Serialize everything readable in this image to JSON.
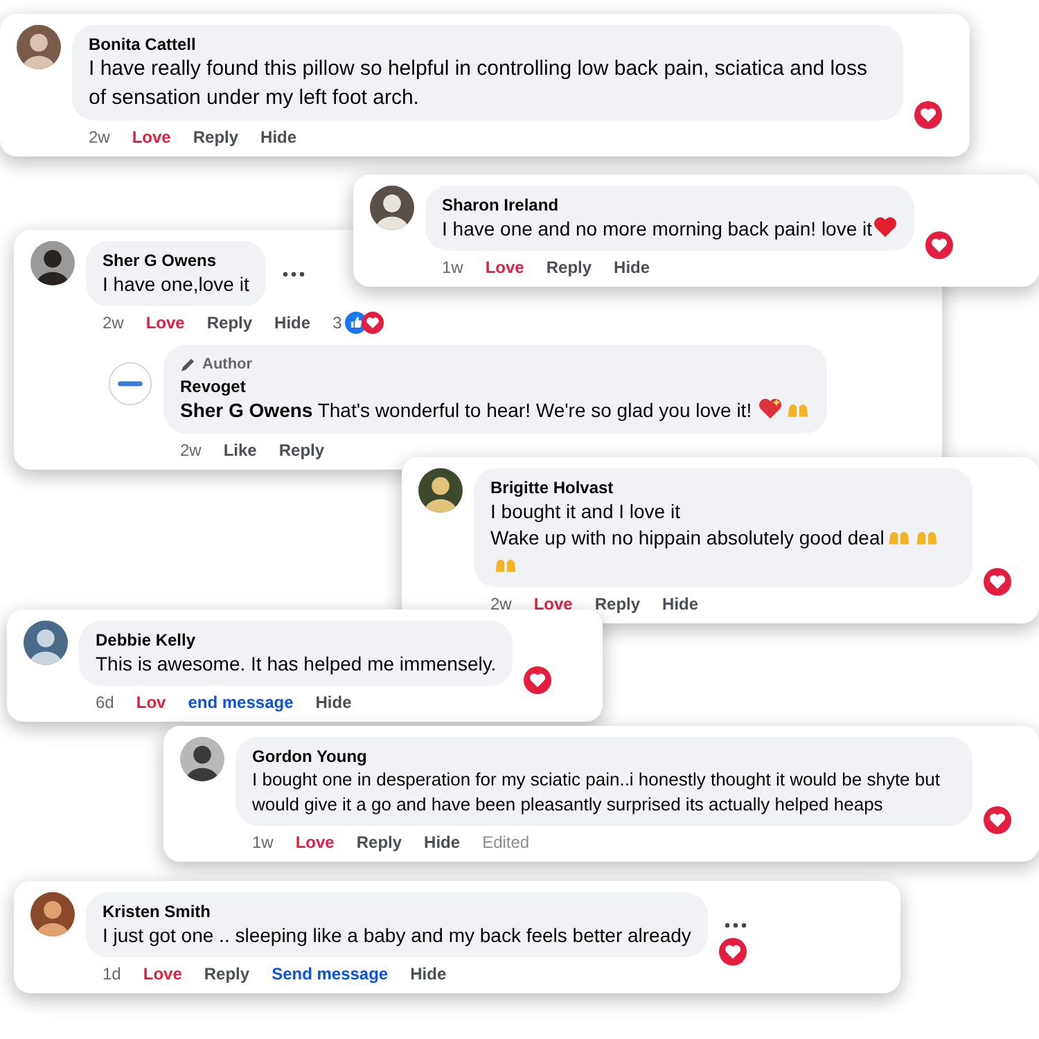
{
  "comments": [
    {
      "author": "Bonita Cattell",
      "text": "I have really found this pillow so helpful in controlling low back pain, sciatica and loss of sensation under my left foot arch.",
      "actions": [
        {
          "label": "2w",
          "kind": "time"
        },
        {
          "label": "Love",
          "kind": "love"
        },
        {
          "label": "Reply",
          "kind": "action"
        },
        {
          "label": "Hide",
          "kind": "action"
        }
      ],
      "loved": true
    },
    {
      "author": "Sharon Ireland",
      "text": "I have one and no more morning back pain! love it",
      "trailing": [
        {
          "kind": "heart"
        }
      ],
      "actions": [
        {
          "label": "1w",
          "kind": "time"
        },
        {
          "label": "Love",
          "kind": "love"
        },
        {
          "label": "Reply",
          "kind": "action"
        },
        {
          "label": "Hide",
          "kind": "action"
        }
      ],
      "loved": true
    },
    {
      "author": "Sher G Owens",
      "text": "I have one,love it",
      "menu": true,
      "actions": [
        {
          "label": "2w",
          "kind": "time"
        },
        {
          "label": "Love",
          "kind": "love"
        },
        {
          "label": "Reply",
          "kind": "action"
        },
        {
          "label": "Hide",
          "kind": "action"
        }
      ],
      "reaction_count": "3",
      "replies": [
        {
          "badge": "Author",
          "author": "Revoget",
          "text": "**Sher G Owens** That's wonderful to hear! We're so glad you love it!",
          "trailing": [
            {
              "kind": "sparkle-heart"
            },
            {
              "kind": "hands"
            }
          ],
          "actions": [
            {
              "label": "2w",
              "kind": "time"
            },
            {
              "label": "Like",
              "kind": "action"
            },
            {
              "label": "Reply",
              "kind": "action"
            }
          ]
        }
      ]
    },
    {
      "author": "Brigitte Holvast",
      "text": "I bought it and I love it\nWake up with no hippain absolutely good deal",
      "trailing": [
        {
          "kind": "hands"
        },
        {
          "kind": "hands"
        },
        {
          "kind": "hands"
        }
      ],
      "actions": [
        {
          "label": "2w",
          "kind": "time"
        },
        {
          "label": "Love",
          "kind": "love"
        },
        {
          "label": "Reply",
          "kind": "action"
        },
        {
          "label": "Hide",
          "kind": "action"
        }
      ],
      "loved": true
    },
    {
      "author": "Debbie Kelly",
      "text": "This is awesome. It has helped me immensely.",
      "actions": [
        {
          "label": "6d",
          "kind": "time"
        },
        {
          "label": "Lov",
          "kind": "love"
        },
        {
          "label": "end message",
          "kind": "link"
        },
        {
          "label": "Hide",
          "kind": "action"
        }
      ],
      "loved": true
    },
    {
      "author": "Gordon Young",
      "text": "I bought one in desperation for my sciatic pain..i honestly thought it would be shyte but would give it a go and have been pleasantly surprised its actually helped heaps",
      "actions": [
        {
          "label": "1w",
          "kind": "time"
        },
        {
          "label": "Love",
          "kind": "love"
        },
        {
          "label": "Reply",
          "kind": "action"
        },
        {
          "label": "Hide",
          "kind": "action"
        },
        {
          "label": "Edited",
          "kind": "note"
        }
      ],
      "loved": true
    },
    {
      "author": "Kristen Smith",
      "text": "I just got one .. sleeping like a baby and my back feels better already",
      "menu": true,
      "actions": [
        {
          "label": "1d",
          "kind": "time"
        },
        {
          "label": "Love",
          "kind": "love"
        },
        {
          "label": "Reply",
          "kind": "action"
        },
        {
          "label": "Send message",
          "kind": "link"
        },
        {
          "label": "Hide",
          "kind": "action"
        }
      ],
      "loved": true
    }
  ]
}
